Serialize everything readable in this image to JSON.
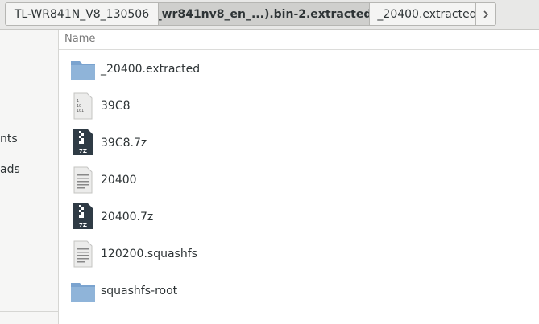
{
  "pathbar": {
    "crumbs": [
      "TL-WR841N_V8_130506",
      "_wr841nv8_en_...).bin-2.extracted",
      "_20400.extracted"
    ],
    "next_icon": "chevron-right-icon"
  },
  "sidebar": {
    "items": [
      "nts",
      "ads"
    ]
  },
  "list": {
    "column_name": "Name",
    "rows": [
      {
        "name": "_20400.extracted",
        "icon": "folder-icon"
      },
      {
        "name": "39C8",
        "icon": "binary-file-icon"
      },
      {
        "name": "39C8.7z",
        "icon": "7z-archive-icon"
      },
      {
        "name": "20400",
        "icon": "text-file-icon"
      },
      {
        "name": "20400.7z",
        "icon": "7z-archive-icon"
      },
      {
        "name": "120200.squashfs",
        "icon": "text-file-icon"
      },
      {
        "name": "squashfs-root",
        "icon": "folder-icon"
      }
    ]
  },
  "colors": {
    "folder": "#8fb4d9",
    "archive": "#2f3b45",
    "active_crumb": "#cfcfcd"
  }
}
